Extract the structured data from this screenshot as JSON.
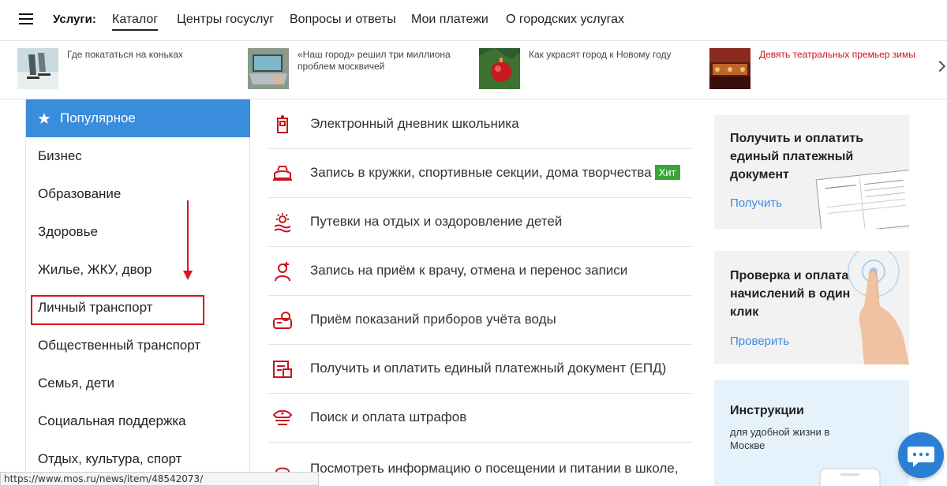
{
  "nav": {
    "title": "Услуги:",
    "items": [
      "Каталог",
      "Центры госуслуг",
      "Вопросы и ответы",
      "Мои платежи",
      "О городских услугах"
    ]
  },
  "news": [
    {
      "text": "Где покататься на коньках",
      "highlight": false
    },
    {
      "text": "«Наш город» решил три миллиона проблем москвичей",
      "highlight": false
    },
    {
      "text": "Как украсят город к Новому году",
      "highlight": false
    },
    {
      "text": "Девять театральных премьер зимы",
      "highlight": true
    }
  ],
  "sidebar": {
    "items": [
      "Популярное",
      "Бизнес",
      "Образование",
      "Здоровье",
      "Жилье, ЖКУ, двор",
      "Личный транспорт",
      "Общественный транспорт",
      "Семья, дети",
      "Социальная поддержка",
      "Отдых, культура, спорт"
    ]
  },
  "main": {
    "items": [
      {
        "label": "Электронный дневник школьника",
        "icon": "school-diary-icon"
      },
      {
        "label": "Запись в кружки, спортивные секции, дома творчества",
        "icon": "hobby-club-icon",
        "badge": "Хит"
      },
      {
        "label": "Путевки на отдых и оздоровление детей",
        "icon": "sun-waves-icon"
      },
      {
        "label": "Запись на приём к врачу, отмена и перенос записи",
        "icon": "doctor-icon"
      },
      {
        "label": "Приём показаний приборов учёта воды",
        "icon": "water-meter-icon"
      },
      {
        "label": "Получить и оплатить единый платежный документ (ЕПД)",
        "icon": "payment-document-icon"
      },
      {
        "label": "Поиск и оплата штрафов",
        "icon": "police-cap-icon"
      },
      {
        "label": "Посмотреть информацию о посещении и питании в школе, детском саду, колледже",
        "icon": "food-icon"
      }
    ]
  },
  "cards": [
    {
      "title": "Получить и оплатить единый платежный документ",
      "link": "Получить"
    },
    {
      "title": "Проверка и оплата начислений в один клик",
      "link": "Проверить"
    },
    {
      "title": "Инструкции",
      "subtitle": "для удобной жизни в Москве"
    }
  ],
  "status_url": "https://www.mos.ru/news/item/48542073/",
  "colors": {
    "accent_blue": "#3a8cdc",
    "icon_red": "#c8141e",
    "badge_green": "#3aa535",
    "annotation_red": "#d8141e"
  }
}
